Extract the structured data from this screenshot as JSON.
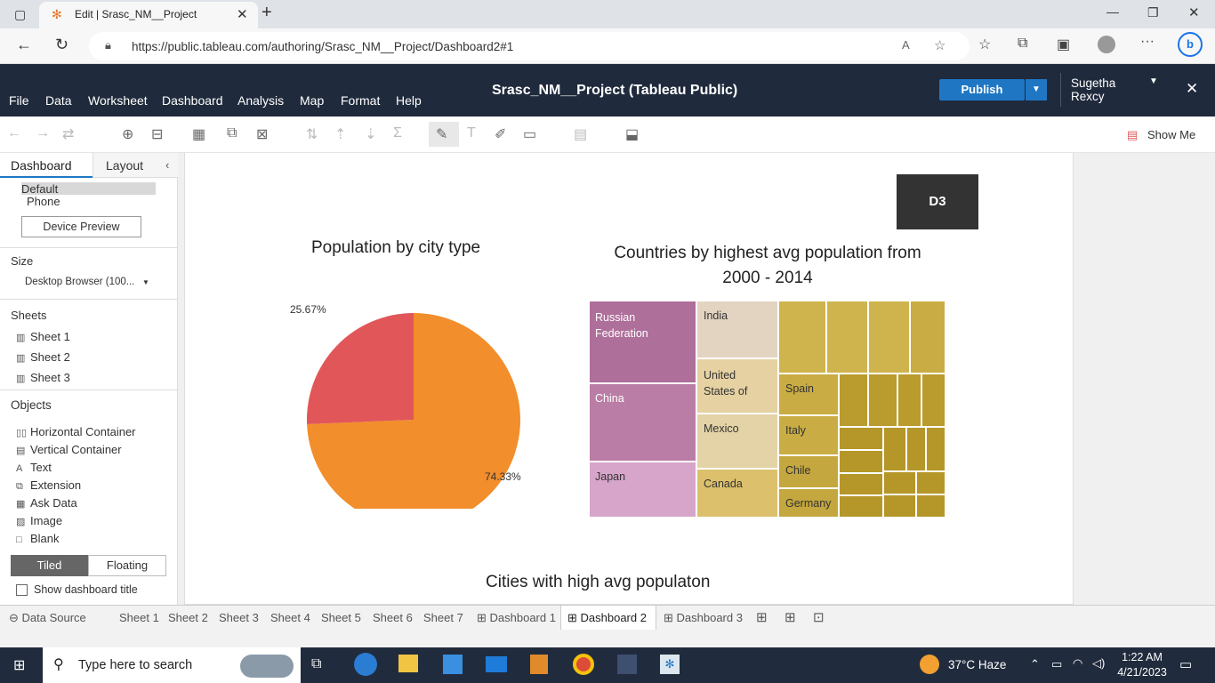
{
  "browser": {
    "tab_title": "Edit | Srasc_NM__Project",
    "url": "https://public.tableau.com/authoring/Srasc_NM__Project/Dashboard2#1"
  },
  "app": {
    "menu": [
      "File",
      "Data",
      "Worksheet",
      "Dashboard",
      "Analysis",
      "Map",
      "Format",
      "Help"
    ],
    "title": "Srasc_NM__Project (Tableau Public)",
    "publish": "Publish",
    "user": "Sugetha Rexcy",
    "show_me": "Show Me"
  },
  "left": {
    "tabs": [
      "Dashboard",
      "Layout"
    ],
    "device_options": [
      "Default",
      "Phone"
    ],
    "device_preview": "Device Preview",
    "size_label": "Size",
    "size_value": "Desktop Browser (100...",
    "sheets_label": "Sheets",
    "sheets": [
      "Sheet 1",
      "Sheet 2",
      "Sheet 3"
    ],
    "objects_label": "Objects",
    "objects": [
      "Horizontal Container",
      "Vertical Container",
      "Text",
      "Extension",
      "Ask Data",
      "Image",
      "Blank"
    ],
    "tiled": "Tiled",
    "floating": "Floating",
    "show_title": "Show dashboard title"
  },
  "dashboard": {
    "badge": "D3",
    "pie_title": "Population by city type",
    "tree_title_1": "Countries by highest avg population from",
    "tree_title_2": "2000 - 2014",
    "bottom_title": "Cities with high avg populaton"
  },
  "chart_data": [
    {
      "type": "pie",
      "title": "Population by city type",
      "slices": [
        {
          "label": "74.33%",
          "value": 74.33,
          "color": "#f28e2b"
        },
        {
          "label": "25.67%",
          "value": 25.67,
          "color": "#e15759"
        }
      ]
    },
    {
      "type": "table",
      "title": "Countries by highest avg population from 2000 - 2014",
      "labeled_cells": [
        "Russian Federation",
        "China",
        "Japan",
        "India",
        "United States of",
        "Mexico",
        "Canada",
        "Spain",
        "Italy",
        "Chile",
        "Germany"
      ]
    }
  ],
  "bottom_tabs": [
    "Data Source",
    "Sheet 1",
    "Sheet 2",
    "Sheet 3",
    "Sheet 4",
    "Sheet 5",
    "Sheet 6",
    "Sheet 7",
    "Dashboard 1",
    "Dashboard 2",
    "Dashboard 3"
  ],
  "taskbar": {
    "search": "Type here to search",
    "weather": "37°C  Haze",
    "time": "1:22 AM",
    "date": "4/21/2023"
  }
}
